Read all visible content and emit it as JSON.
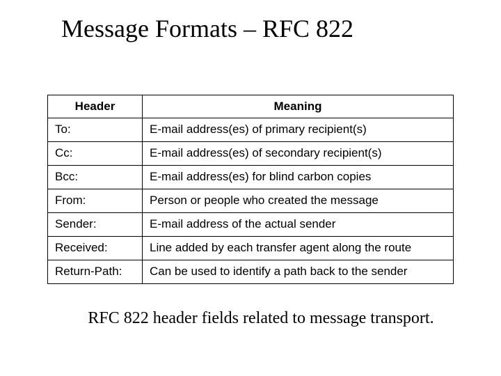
{
  "title": "Message Formats – RFC 822",
  "table": {
    "columns": [
      "Header",
      "Meaning"
    ],
    "rows": [
      {
        "header": "To:",
        "meaning": "E-mail address(es) of primary recipient(s)"
      },
      {
        "header": "Cc:",
        "meaning": "E-mail address(es) of secondary recipient(s)"
      },
      {
        "header": "Bcc:",
        "meaning": "E-mail address(es) for blind carbon copies"
      },
      {
        "header": "From:",
        "meaning": "Person or people who created the message"
      },
      {
        "header": "Sender:",
        "meaning": "E-mail address of the actual sender"
      },
      {
        "header": "Received:",
        "meaning": "Line added by each transfer agent along the route"
      },
      {
        "header": "Return-Path:",
        "meaning": "Can be used to identify a path back to the sender"
      }
    ]
  },
  "caption": "RFC 822 header fields related to message transport."
}
